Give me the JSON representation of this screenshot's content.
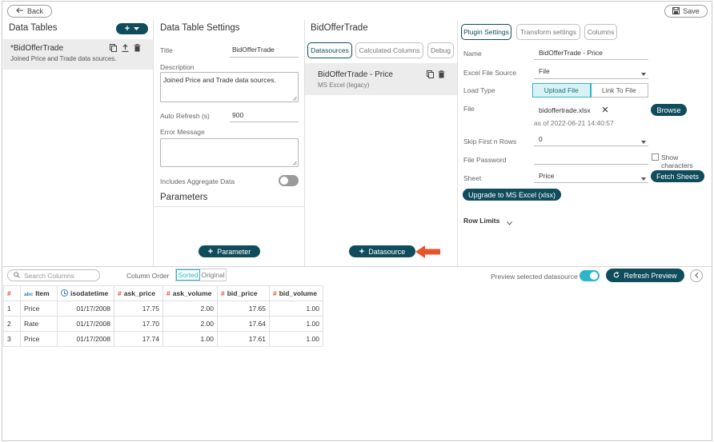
{
  "header": {
    "back_label": "Back",
    "save_label": "Save"
  },
  "data_tables": {
    "title": "Data Tables",
    "add_label": "+",
    "item": {
      "name": "*BidOfferTrade",
      "description": "Joined Price and Trade data sources."
    }
  },
  "settings": {
    "title": "Data Table Settings",
    "title_label": "Title",
    "title_value": "BidOfferTrade",
    "description_label": "Description",
    "description_value": "Joined Price and Trade data sources.",
    "auto_refresh_label": "Auto Refresh (s)",
    "auto_refresh_value": "900",
    "error_message_label": "Error Message",
    "error_message_value": "",
    "aggregate_label": "Includes Aggregate Data",
    "aggregate_on": false,
    "parameters_title": "Parameters",
    "add_parameter_label": "Parameter"
  },
  "datasources": {
    "title": "BidOfferTrade",
    "tabs": [
      "Datasources",
      "Calculated Columns",
      "Debug"
    ],
    "active_tab": 0,
    "item": {
      "name": "BidOfferTrade - Price",
      "type": "MS Excel (legacy)"
    },
    "add_datasource_label": "Datasource"
  },
  "plugin": {
    "tabs": [
      "Plugin Settings",
      "Transform settings",
      "Columns"
    ],
    "active_tab": 0,
    "name_label": "Name",
    "name_value": "BidOfferTrade - Price",
    "excel_source_label": "Excel File Source",
    "excel_source_value": "File",
    "load_type_label": "Load Type",
    "load_type_options": [
      "Upload File",
      "Link To File"
    ],
    "load_type_selected": 0,
    "file_label": "File",
    "file_value": "bidoffertrade.xlsx",
    "file_date": "as of 2022-06-21 14:40:57",
    "browse_label": "Browse",
    "skip_rows_label": "Skip First n Rows",
    "skip_rows_value": "0",
    "password_label": "File Password",
    "password_value": "",
    "show_chars_label": "Show characters",
    "sheet_label": "Sheet",
    "sheet_value": "Price",
    "fetch_sheets_label": "Fetch Sheets",
    "upgrade_label": "Upgrade to MS Excel (xlsx)",
    "row_limits_label": "Row Limits"
  },
  "preview": {
    "search_placeholder": "Search Columns",
    "column_order_label": "Column Order",
    "order_options": [
      "Sorted",
      "Original"
    ],
    "order_selected": 0,
    "preview_selected_label": "Preview selected datasource",
    "preview_on": true,
    "refresh_label": "Refresh Preview",
    "columns": [
      {
        "type": "#",
        "name": ""
      },
      {
        "type": "abc",
        "name": "Item"
      },
      {
        "type": "time",
        "name": "isodatetime"
      },
      {
        "type": "#",
        "name": "ask_price"
      },
      {
        "type": "#",
        "name": "ask_volume"
      },
      {
        "type": "#",
        "name": "bid_price"
      },
      {
        "type": "#",
        "name": "bid_volume"
      }
    ],
    "rows": [
      [
        "1",
        "Price",
        "01/17/2008",
        "17.75",
        "2.00",
        "17.65",
        "1.00"
      ],
      [
        "2",
        "Rate",
        "01/17/2008",
        "17.70",
        "2.00",
        "17.64",
        "1.00"
      ],
      [
        "3",
        "Price",
        "01/17/2008",
        "17.74",
        "1.00",
        "17.61",
        "1.00"
      ]
    ]
  },
  "colors": {
    "accent": "#0f4c5c",
    "toggle_on": "#2bb6c9",
    "hash": "#e04b2f",
    "arrow": "#e8542a"
  }
}
